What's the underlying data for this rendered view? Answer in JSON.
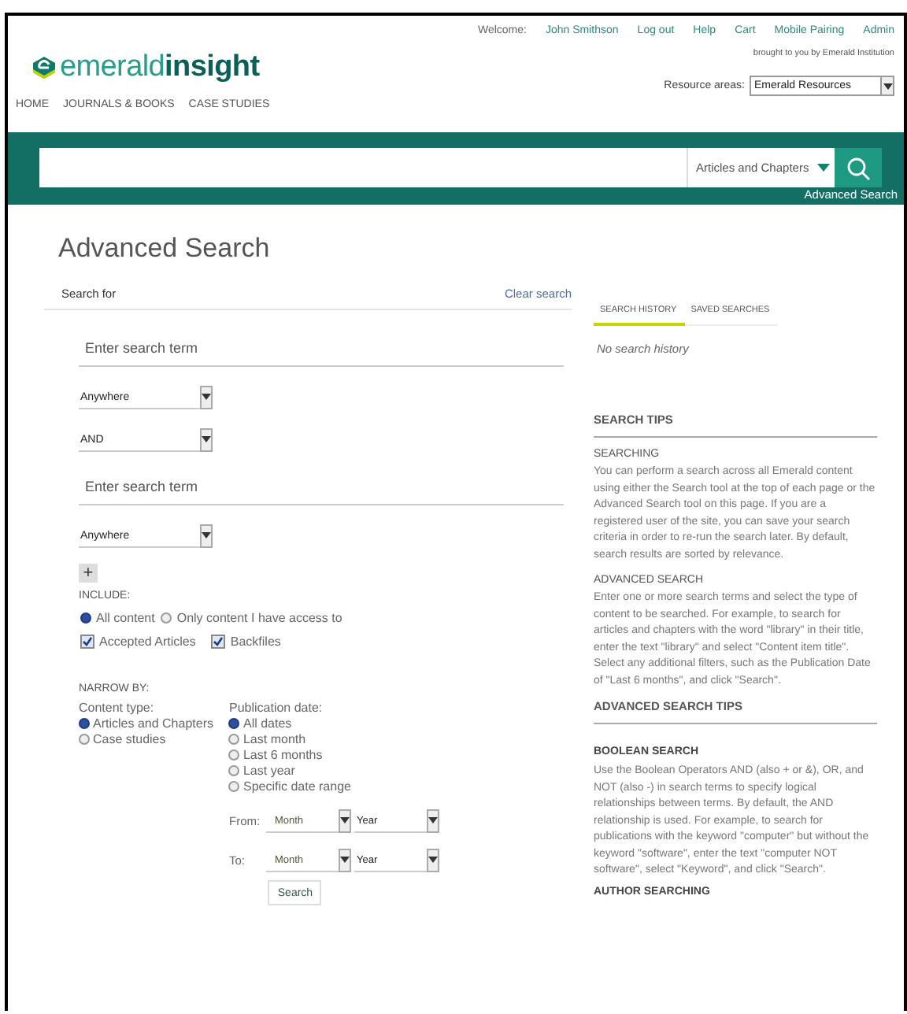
{
  "header": {
    "welcome_label": "Welcome:",
    "user_name": "John Smithson",
    "links": [
      "Log out",
      "Help",
      "Cart",
      "Mobile Pairing",
      "Admin"
    ],
    "brought_by": "brought to you by Emerald Institution",
    "logo": {
      "light": "emerald",
      "bold": "insight"
    },
    "nav": [
      "HOME",
      "JOURNALS & BOOKS",
      "CASE STUDIES"
    ],
    "resource_areas": {
      "label": "Resource areas:",
      "value": "Emerald Resources"
    }
  },
  "search_bar": {
    "scope": "Articles and Chapters",
    "advanced_link": "Advanced Search"
  },
  "advanced": {
    "title": "Advanced Search",
    "search_for": "Search for",
    "clear_link": "Clear search",
    "rows": [
      {
        "kind": "term",
        "placeholder": "Enter search term"
      },
      {
        "kind": "select",
        "value": "Anywhere"
      },
      {
        "kind": "select",
        "value": "AND"
      },
      {
        "kind": "term",
        "placeholder": "Enter search term"
      },
      {
        "kind": "select",
        "value": "Anywhere"
      }
    ],
    "add_button": "+",
    "include": {
      "label": "INCLUDE:",
      "radios": [
        {
          "label": "All content",
          "selected": true
        },
        {
          "label": "Only content I have access to",
          "selected": false
        }
      ],
      "checkboxes": [
        {
          "label": "Accepted Articles",
          "checked": true
        },
        {
          "label": "Backfiles",
          "checked": true
        }
      ]
    },
    "narrow": {
      "label": "NARROW BY:",
      "content_type": {
        "label": "Content type:",
        "options": [
          {
            "label": "Articles and Chapters",
            "selected": true
          },
          {
            "label": "Case studies",
            "selected": false
          }
        ]
      },
      "publication_date": {
        "label": "Publication date:",
        "options": [
          {
            "label": "All dates",
            "selected": true
          },
          {
            "label": "Last month",
            "selected": false
          },
          {
            "label": "Last 6 months",
            "selected": false
          },
          {
            "label": "Last year",
            "selected": false
          },
          {
            "label": "Specific date range",
            "selected": false
          }
        ]
      },
      "ranges": [
        {
          "label": "From:",
          "month": "Month",
          "year": "Year"
        },
        {
          "label": "To:",
          "month": "Month",
          "year": "Year"
        }
      ]
    },
    "search_button": "Search"
  },
  "sidebar": {
    "tabs": [
      {
        "label": "SEARCH HISTORY",
        "selected": true
      },
      {
        "label": "SAVED SEARCHES",
        "selected": false
      }
    ],
    "empty_text": "No search history",
    "tips": [
      {
        "kind": "title",
        "text": "SEARCH TIPS"
      },
      {
        "kind": "sub",
        "text": "SEARCHING"
      },
      {
        "kind": "para",
        "text": "You can perform a search across all Emerald content using either the Search tool at the top of each page or the Advanced Search tool on this page. If you are a registered user of the site, you can save your search criteria in order to re-run the search later. By default, search results are sorted by relevance."
      },
      {
        "kind": "sub",
        "text": "ADVANCED SEARCH"
      },
      {
        "kind": "para",
        "text": "Enter one or more search terms and select the type of content to be searched. For example, to search for articles and chapters with the word \"library\" in their title, enter the text \"library\" and select \"Content item title\". Select any additional filters, such as the Publication Date of \"Last 6 months\", and click \"Search\"."
      },
      {
        "kind": "title",
        "text": "ADVANCED SEARCH TIPS"
      },
      {
        "kind": "bold",
        "text": "BOOLEAN SEARCH"
      },
      {
        "kind": "para",
        "text": "Use the Boolean Operators AND (also + or &), OR, and NOT (also -) in search terms to specify logical relationships between terms. By default, the AND relationship is used. For example, to search for publications with the keyword \"computer\" but without the keyword \"software\", enter the text \"computer NOT software\", select \"Keyword\", and click \"Search\"."
      },
      {
        "kind": "bold",
        "text": "AUTHOR SEARCHING"
      }
    ]
  }
}
